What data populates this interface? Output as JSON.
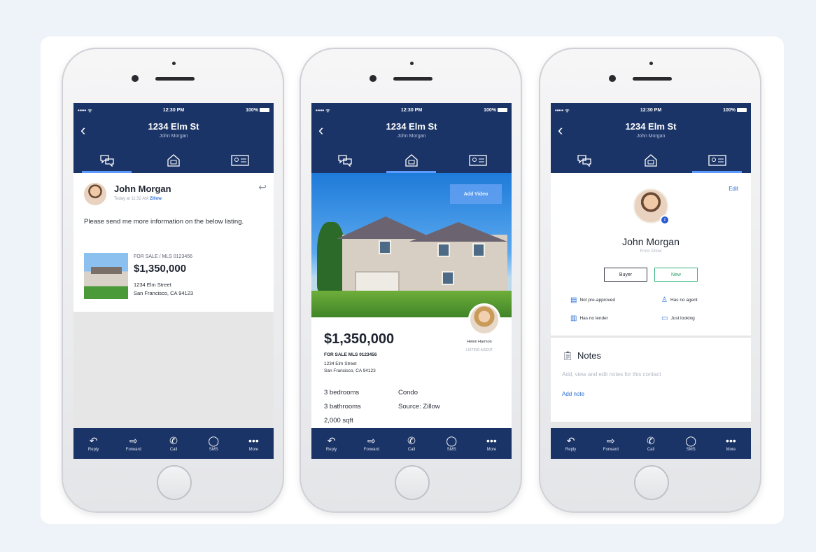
{
  "status_bar": {
    "signal": "••••• ᯤ",
    "time": "12:30 PM",
    "battery": "100%"
  },
  "header": {
    "title": "1234 Elm St",
    "subtitle": "John Morgan"
  },
  "tabs": [
    "Messages",
    "Listing",
    "Contact"
  ],
  "toolbar": [
    {
      "label": "Reply",
      "icon": "reply-icon"
    },
    {
      "label": "Forward",
      "icon": "forward-icon"
    },
    {
      "label": "Call",
      "icon": "phone-icon"
    },
    {
      "label": "SMS",
      "icon": "sms-icon"
    },
    {
      "label": "More",
      "icon": "more-icon"
    }
  ],
  "message": {
    "sender": "John Morgan",
    "meta": "Today at 11:32 AM",
    "source": "Zillow",
    "body": "Please send me more information on the below listing.",
    "listing": {
      "status": "FOR SALE / MLS 0123456",
      "price": "$1,350,000",
      "address_line1": "1234 Elm Street",
      "address_line2": "San Francisco, CA 94123"
    }
  },
  "listing_screen": {
    "add_video": "Add Video",
    "agent_name": "Helen Harmon",
    "agent_role": "LISTING AGENT",
    "price": "$1,350,000",
    "status": "FOR SALE  MLS 0123456",
    "address_line1": "1234 Elm Street",
    "address_line2": "San Francisco, CA 94123",
    "features": [
      {
        "label": "3 bedrooms"
      },
      {
        "label": "Condo"
      },
      {
        "label": "3 bathrooms"
      },
      {
        "label": "Source: Zillow"
      },
      {
        "label": "2,000 sqft"
      }
    ]
  },
  "contact_screen": {
    "edit": "Edit",
    "name": "John Morgan",
    "source": "From Zillow",
    "type": "Buyer",
    "stage": "New",
    "tags": [
      "Not pre-approved",
      "Has no agent",
      "Has no lender",
      "Just looking"
    ],
    "notes_title": "Notes",
    "notes_help": "Add, view and edit notes for this contact",
    "notes_add": "Add note"
  },
  "colors": {
    "navy": "#1b3467",
    "accent": "#5b9bff",
    "link": "#2b6fd6",
    "new_green": "#36b37e"
  }
}
